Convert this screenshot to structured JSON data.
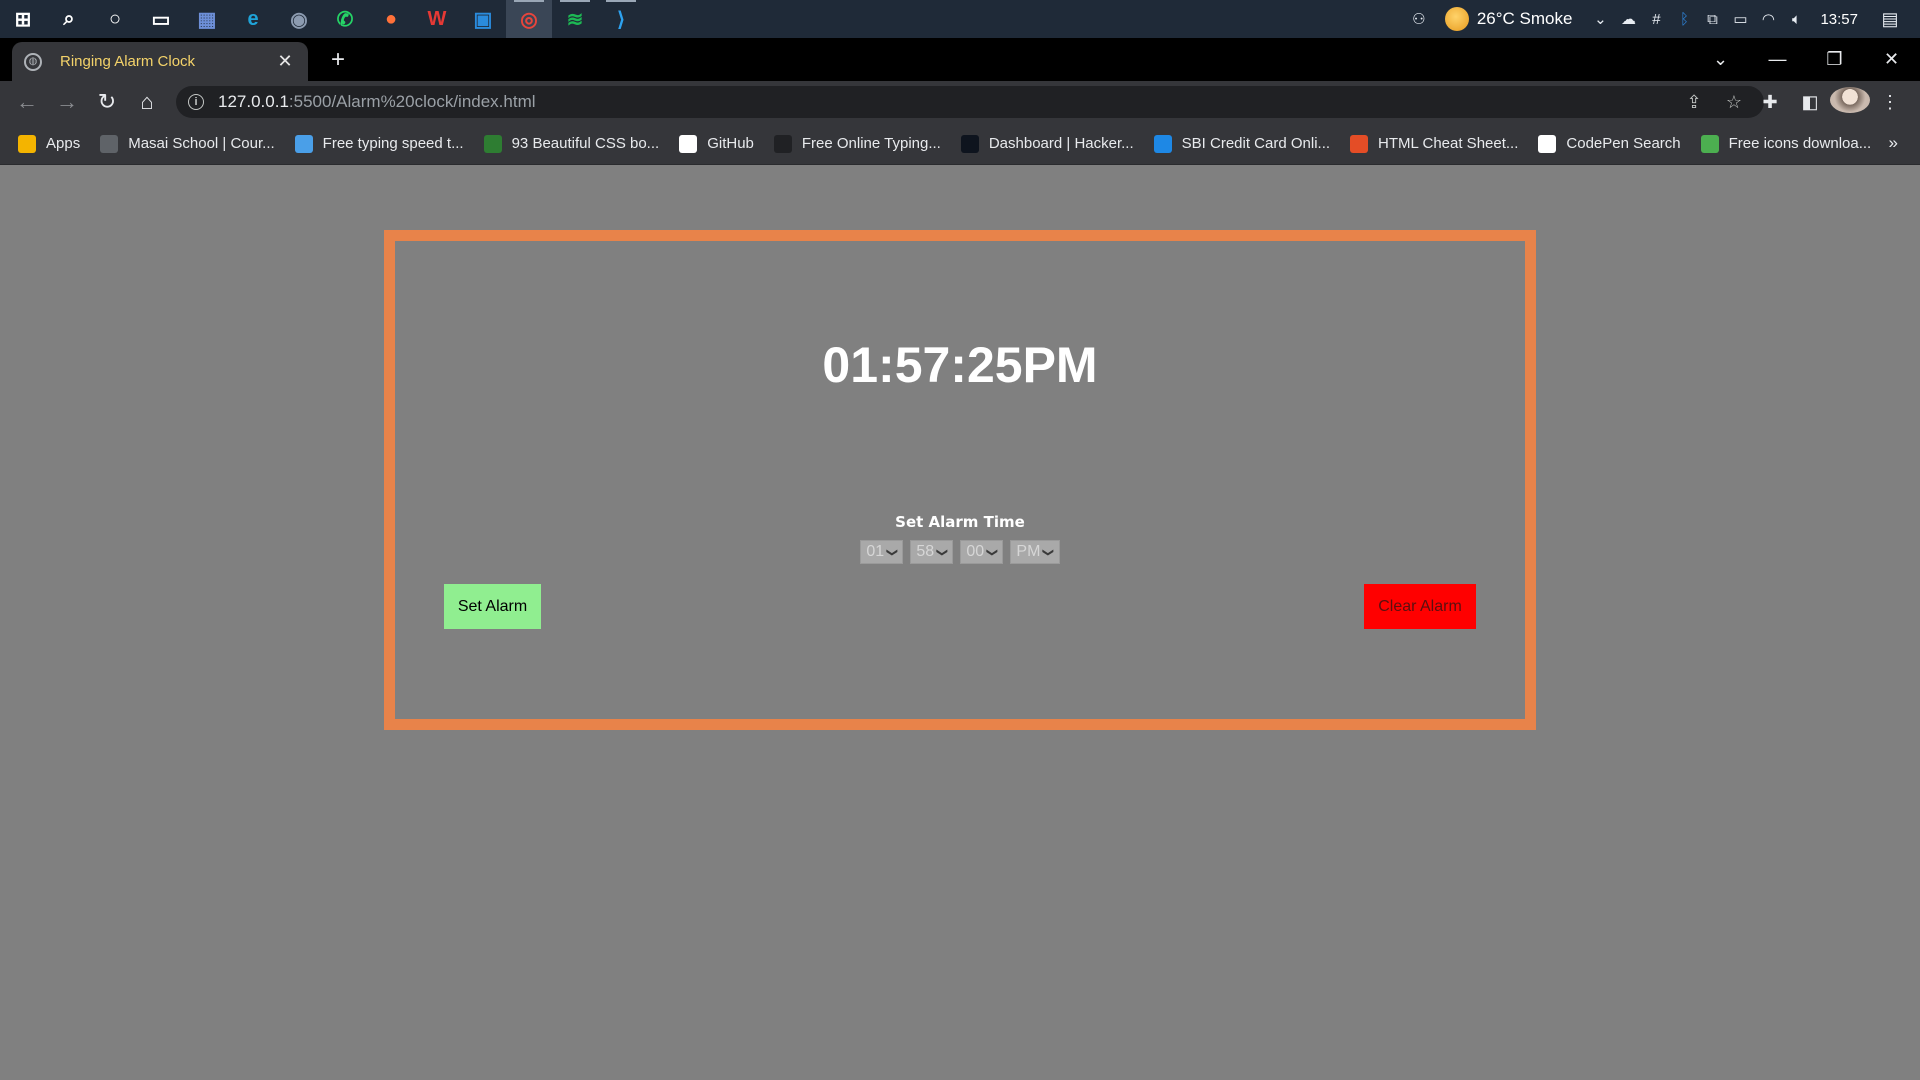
{
  "taskbar": {
    "apps": [
      {
        "name": "windows-start",
        "glyph": "⊞",
        "color": "#ffffff"
      },
      {
        "name": "search",
        "glyph": "⌕",
        "color": "#ffffff"
      },
      {
        "name": "cortana",
        "glyph": "○",
        "color": "#ffffff"
      },
      {
        "name": "task-view",
        "glyph": "▭",
        "color": "#ffffff"
      },
      {
        "name": "calculator",
        "glyph": "▦",
        "color": "#6d8fd8"
      },
      {
        "name": "edge",
        "glyph": "e",
        "color": "#1fa3d8"
      },
      {
        "name": "camera",
        "glyph": "◉",
        "color": "#8c9bb0"
      },
      {
        "name": "whatsapp",
        "glyph": "✆",
        "color": "#25d366"
      },
      {
        "name": "firefox",
        "glyph": "●",
        "color": "#ff7139"
      },
      {
        "name": "wps",
        "glyph": "W",
        "color": "#e53935"
      },
      {
        "name": "store",
        "glyph": "▣",
        "color": "#2a8bdc"
      },
      {
        "name": "chrome",
        "glyph": "◎",
        "color": "#e8453c"
      },
      {
        "name": "spotify",
        "glyph": "≋",
        "color": "#1db954"
      },
      {
        "name": "vscode",
        "glyph": "⟩",
        "color": "#2da2f0"
      }
    ],
    "tray": {
      "weather": "26°C  Smoke",
      "time": "13:57"
    }
  },
  "browser": {
    "tab_title": "Ringing Alarm Clock",
    "url_host": "127.0.0.1",
    "url_rest": ":5500/Alarm%20clock/index.html",
    "bookmarks": [
      {
        "label": "Apps",
        "icon": "apps-grid-icon",
        "color": "#f4b400"
      },
      {
        "label": "Masai School | Cour...",
        "icon": "globe-icon",
        "color": "#5f6368"
      },
      {
        "label": "Free typing speed t...",
        "icon": "typing-icon",
        "color": "#4a9fe8"
      },
      {
        "label": "93 Beautiful CSS bo...",
        "icon": "css-icon",
        "color": "#2e7d32"
      },
      {
        "label": "GitHub",
        "icon": "github-icon",
        "color": "#ffffff"
      },
      {
        "label": "Free Online Typing...",
        "icon": "paw-icon",
        "color": "#202124"
      },
      {
        "label": "Dashboard | Hacker...",
        "icon": "hackerrank-icon",
        "color": "#0e141e"
      },
      {
        "label": "SBI Credit Card Onli...",
        "icon": "sbi-icon",
        "color": "#1e88e5"
      },
      {
        "label": "HTML Cheat Sheet...",
        "icon": "html-icon",
        "color": "#e44d26"
      },
      {
        "label": "CodePen Search",
        "icon": "codepen-icon",
        "color": "#ffffff"
      },
      {
        "label": "Free icons downloa...",
        "icon": "flaticon-icon",
        "color": "#4caf50"
      }
    ],
    "more": "»"
  },
  "page": {
    "clock": "01:57:25PM",
    "set_label": "Set Alarm Time",
    "alarm": {
      "hour": "01",
      "minute": "58",
      "second": "00",
      "ampm": "PM"
    },
    "set_button": "Set Alarm",
    "clear_button": "Clear Alarm",
    "colors": {
      "background": "#808080",
      "border": "#e8834a",
      "set_button": "#90ee90",
      "clear_button": "#ff0000"
    }
  }
}
